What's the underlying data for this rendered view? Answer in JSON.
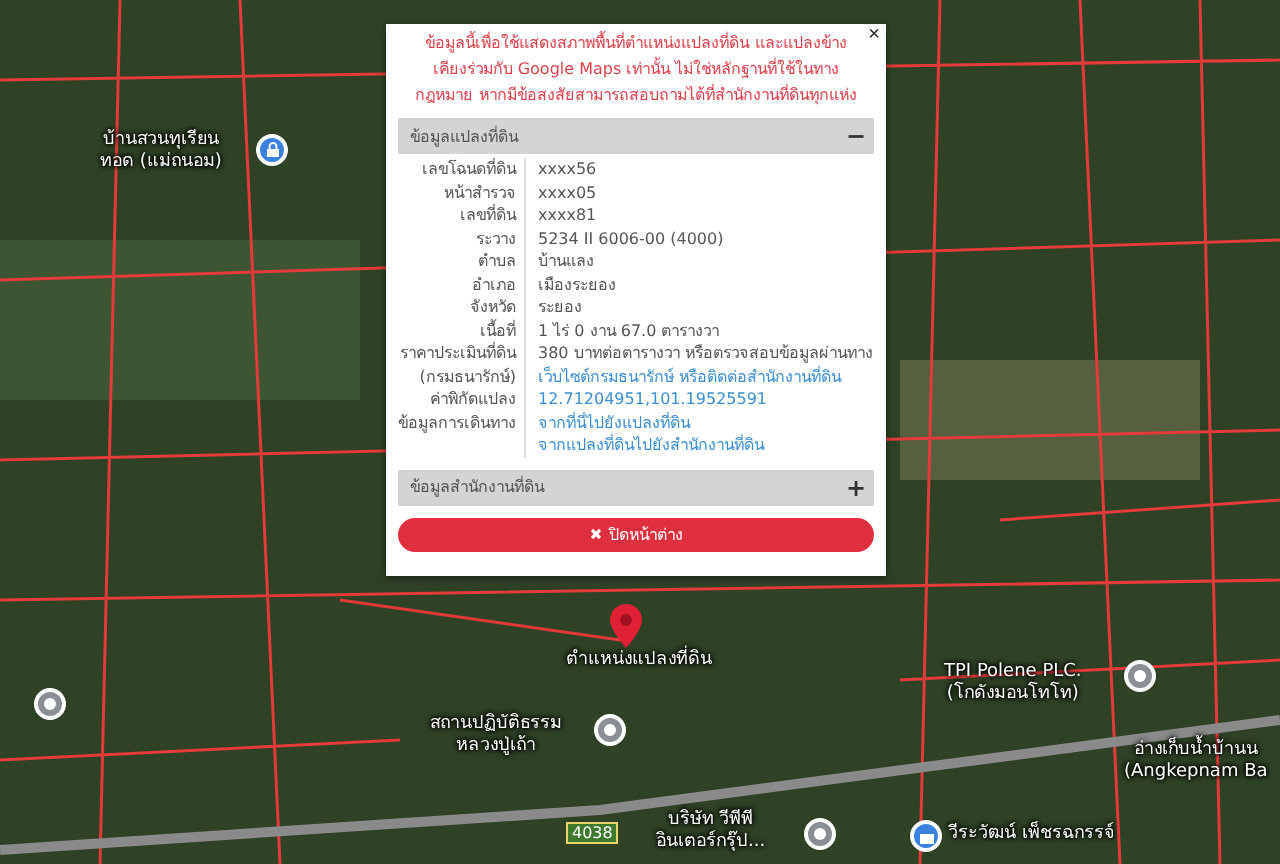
{
  "map": {
    "road_number": "4038",
    "places": [
      {
        "lines": [
          "บ้านสวนทุเรียน",
          "ทอด (แม่ถนอม)"
        ],
        "kind": "lock"
      },
      {
        "lines": [
          "ตำแหน่งแปลงที่ดิน"
        ],
        "kind": "marker"
      },
      {
        "lines": [
          "สถานปฏิบัติธรรม",
          "หลวงปู่เถ้า"
        ],
        "kind": "place"
      },
      {
        "lines": [
          "TPI Polene PLC.",
          "(โกดังมอนโทโท)"
        ],
        "kind": "place"
      },
      {
        "lines": [
          "อ่างเก็บน้ำบ้านน",
          "(Angkepnam Ba"
        ],
        "kind": "none"
      },
      {
        "lines": [
          "บริษัท วีพีพี",
          "อินเตอร์กรุ๊ป..."
        ],
        "kind": "place"
      },
      {
        "lines": [
          "วีระวัฒน์ เพ็ชรฉกรรจ์"
        ],
        "kind": "shop"
      },
      {
        "kind": "place"
      }
    ]
  },
  "popup": {
    "close": "×",
    "notice": "ข้อมูลนี้เพื่อใช้แสดงสภาพพื้นที่ตำแหน่งแปลงที่ดิน และแปลงข้างเคียงร่วมกับ Google Maps เท่านั้น ไม่ใช่หลักฐานที่ใช้ในทางกฎหมาย หากมีข้อสงสัยสามารถสอบถามได้ที่สำนักงานที่ดินทุกแห่ง",
    "sections": [
      {
        "title": "ข้อมูลแปลงที่ดิน",
        "toggle": "−",
        "rows": [
          {
            "label": [
              "เลขโฉนดที่ดิน"
            ],
            "values": [
              {
                "text": "xxxx56",
                "kind": "text"
              }
            ]
          },
          {
            "label": [
              "หน้าสำรวจ"
            ],
            "values": [
              {
                "text": "xxxx05",
                "kind": "text"
              }
            ]
          },
          {
            "label": [
              "เลขที่ดิน"
            ],
            "values": [
              {
                "text": "xxxx81",
                "kind": "text"
              }
            ]
          },
          {
            "label": [
              "ระวาง"
            ],
            "values": [
              {
                "text": "5234 II 6006-00 (4000)",
                "kind": "text"
              }
            ]
          },
          {
            "label": [
              "ตำบล"
            ],
            "values": [
              {
                "text": "บ้านแลง",
                "kind": "text"
              }
            ]
          },
          {
            "label": [
              "อำเภอ"
            ],
            "values": [
              {
                "text": "เมืองระยอง",
                "kind": "text"
              }
            ]
          },
          {
            "label": [
              "จังหวัด"
            ],
            "values": [
              {
                "text": "ระยอง",
                "kind": "text"
              }
            ]
          },
          {
            "label": [
              "เนื้อที่"
            ],
            "values": [
              {
                "text": "1 ไร่ 0 งาน 67.0 ตารางวา",
                "kind": "text"
              }
            ]
          },
          {
            "label": [
              "ราคาประเมินที่ดิน",
              "(กรมธนารักษ์)"
            ],
            "values": [
              {
                "text": "380 บาทต่อตารางวา หรือตรวจสอบข้อมูลผ่านทาง",
                "kind": "text"
              },
              {
                "text": "เว็บไซต์กรมธนารักษ์ หรือติดต่อสำนักงานที่ดิน",
                "kind": "link"
              }
            ]
          },
          {
            "label": [
              "ค่าพิกัดแปลง"
            ],
            "values": [
              {
                "text": "12.71204951,101.19525591",
                "kind": "link"
              }
            ]
          },
          {
            "label": [
              "ข้อมูลการเดินทาง"
            ],
            "values": [
              {
                "text": "จากที่นี่ไปยังแปลงที่ดิน",
                "kind": "link"
              },
              {
                "text": "จากแปลงที่ดินไปยังสำนักงานที่ดิน",
                "kind": "link"
              }
            ]
          }
        ]
      },
      {
        "title": "ข้อมูลสำนักงานที่ดิน",
        "toggle": "+"
      }
    ],
    "close_button": "ปิดหน้าต่าง"
  }
}
